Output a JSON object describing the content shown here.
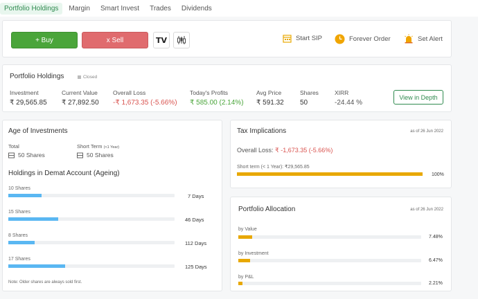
{
  "tabs": [
    {
      "label": "Portfolio Holdings",
      "active": true
    },
    {
      "label": "Margin"
    },
    {
      "label": "Smart Invest"
    },
    {
      "label": "Trades"
    },
    {
      "label": "Dividends"
    }
  ],
  "toolbar": {
    "buy_label": "+ Buy",
    "sell_label": "x Sell",
    "start_sip": "Start SIP",
    "forever_order": "Forever Order",
    "set_alert": "Set Alert",
    "colors": {
      "buy": "#4aa53a",
      "sell": "#e06b6e"
    }
  },
  "summary": {
    "title": "Portfolio Holdings",
    "status": "Closed",
    "investment": {
      "label": "Investment",
      "value": "₹ 29,565.85"
    },
    "current_value": {
      "label": "Current Value",
      "value": "₹ 27,892.50"
    },
    "overall_loss": {
      "label": "Overall Loss",
      "value": "-₹ 1,673.35 (-5.66%)"
    },
    "todays_profits": {
      "label": "Today's Profits",
      "value": "₹ 585.00 (2.14%)"
    },
    "avg_price": {
      "label": "Avg Price",
      "value": "₹ 591.32"
    },
    "shares": {
      "label": "Shares",
      "value": "50"
    },
    "xirr": {
      "label": "XIRR",
      "value": "-24.44 %"
    },
    "view_depth": "View in Depth"
  },
  "age": {
    "title": "Age of Investments",
    "total_label": "Total",
    "total_value": "50 Shares",
    "short_label": "Short Term",
    "short_sub": "(<1 Year)",
    "short_value": "50 Shares",
    "demat_title": "Holdings in Demat Account (Ageing)",
    "rows": [
      {
        "label": "10 Shares",
        "days": "7 Days",
        "fraction": 0.2
      },
      {
        "label": "15 Shares",
        "days": "46 Days",
        "fraction": 0.3
      },
      {
        "label": "8 Shares",
        "days": "112 Days",
        "fraction": 0.16
      },
      {
        "label": "17 Shares",
        "days": "125 Days",
        "fraction": 0.34
      }
    ],
    "note": "Note: Older shares are always sold first."
  },
  "tax": {
    "title": "Tax Implications",
    "date": "as of 26 Jun 2022",
    "loss_label": "Overall Loss:",
    "loss_value": "₹ -1,673.35 (-5.66%)",
    "short_label": "Short term (< 1 Year): ₹29,565.85",
    "short_pct": "100%",
    "short_fraction": 1.0
  },
  "allocation": {
    "title": "Portfolio Allocation",
    "date": "as of 26 Jun 2022",
    "rows": [
      {
        "label": "by Value",
        "pct": "7.48%",
        "fraction": 0.0748
      },
      {
        "label": "by Investment",
        "pct": "6.47%",
        "fraction": 0.0647
      },
      {
        "label": "by P&L",
        "pct": "2.21%",
        "fraction": 0.0221
      }
    ]
  }
}
